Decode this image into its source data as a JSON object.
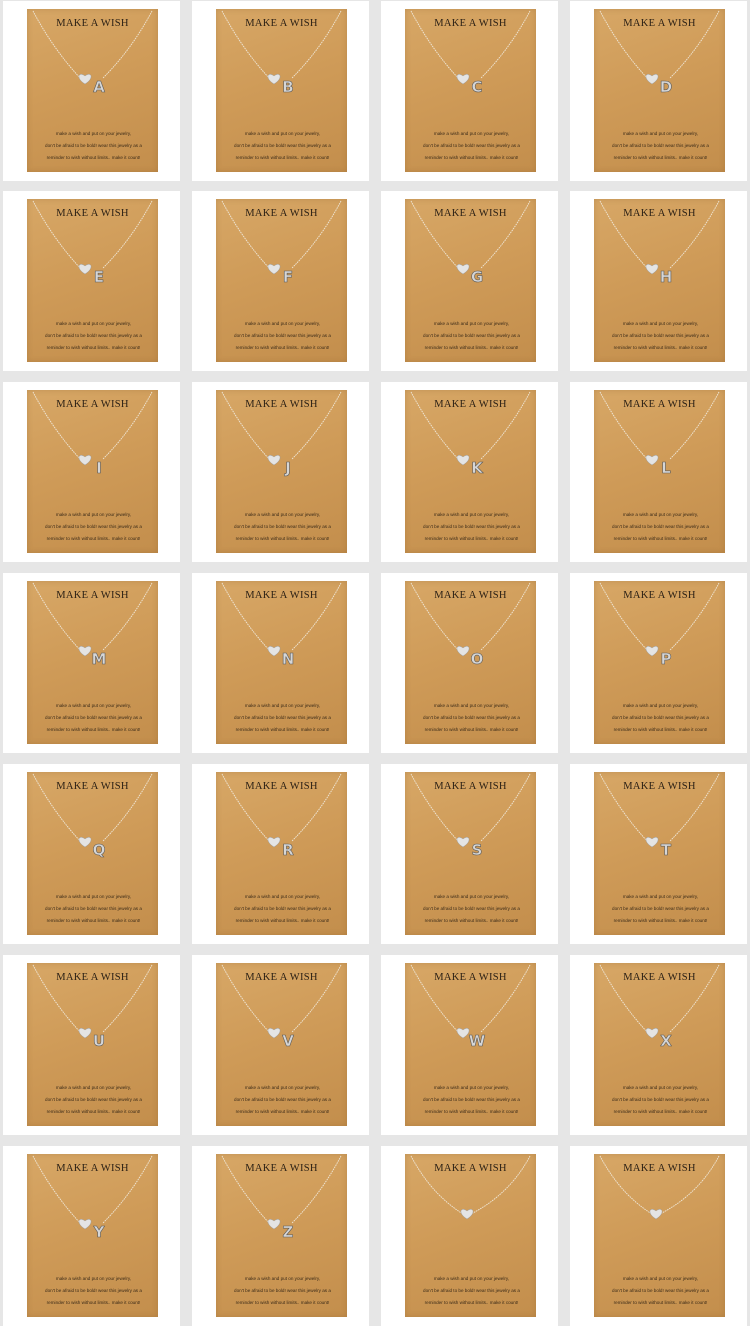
{
  "card_title": "MAKE A WISH",
  "card_message": "make a wish and put on your jewelry,\ndon't be afraid to be bold! wear this jewelry as a\nreminder to wish without limits.. make it count!",
  "card_color": "#cf9b58",
  "pendant_color": "#e4e4e4",
  "cards": [
    {
      "letter": "A"
    },
    {
      "letter": "B"
    },
    {
      "letter": "C"
    },
    {
      "letter": "D"
    },
    {
      "letter": "E"
    },
    {
      "letter": "F"
    },
    {
      "letter": "G"
    },
    {
      "letter": "H"
    },
    {
      "letter": "I"
    },
    {
      "letter": "J"
    },
    {
      "letter": "K"
    },
    {
      "letter": "L"
    },
    {
      "letter": "M"
    },
    {
      "letter": "N"
    },
    {
      "letter": "O"
    },
    {
      "letter": "P"
    },
    {
      "letter": "Q"
    },
    {
      "letter": "R"
    },
    {
      "letter": "S"
    },
    {
      "letter": "T"
    },
    {
      "letter": "U"
    },
    {
      "letter": "V"
    },
    {
      "letter": "W"
    },
    {
      "letter": "X"
    },
    {
      "letter": "Y"
    },
    {
      "letter": "Z"
    },
    {
      "letter": ""
    },
    {
      "letter": ""
    }
  ]
}
